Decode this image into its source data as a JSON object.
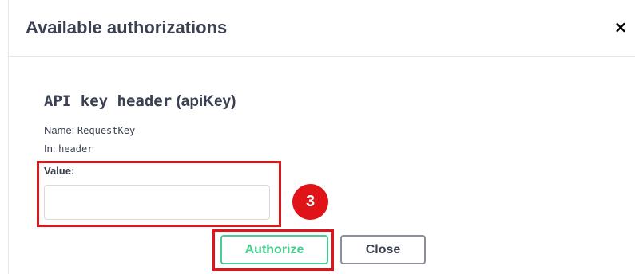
{
  "modal": {
    "title": "Available authorizations",
    "close_icon": "close-icon",
    "close_glyph": "×"
  },
  "scheme": {
    "title_code": "API key header",
    "title_name": "(apiKey)",
    "name_label": "Name:",
    "name_value": "RequestKey",
    "in_label": "In:",
    "in_value": "header",
    "value_label": "Value:",
    "value_input": ""
  },
  "actions": {
    "authorize_label": "Authorize",
    "close_label": "Close"
  },
  "annotation": {
    "step_number": "3",
    "highlight_color": "#e0151a"
  },
  "colors": {
    "authorize_green": "#49cc90",
    "text": "#3b4151"
  }
}
